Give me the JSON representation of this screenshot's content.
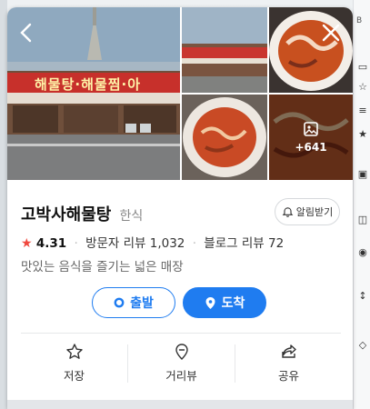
{
  "place": {
    "name": "고박사해물탕",
    "category": "한식",
    "rating": "4.31",
    "visitor_reviews": "방문자 리뷰 1,032",
    "blog_reviews": "블로그 리뷰 72",
    "description": "맛있는 음식을 즐기는 넓은 매장"
  },
  "photos": {
    "more_count": "+641",
    "sign_text": "해물탕·해물찜·아"
  },
  "buttons": {
    "alarm_label": "알림받기",
    "depart_label": "출발",
    "arrive_label": "도착"
  },
  "actions": {
    "save_label": "저장",
    "street_view_label": "거리뷰",
    "share_label": "공유"
  },
  "colors": {
    "accent": "#1f7cf0",
    "star": "#f0483e"
  }
}
